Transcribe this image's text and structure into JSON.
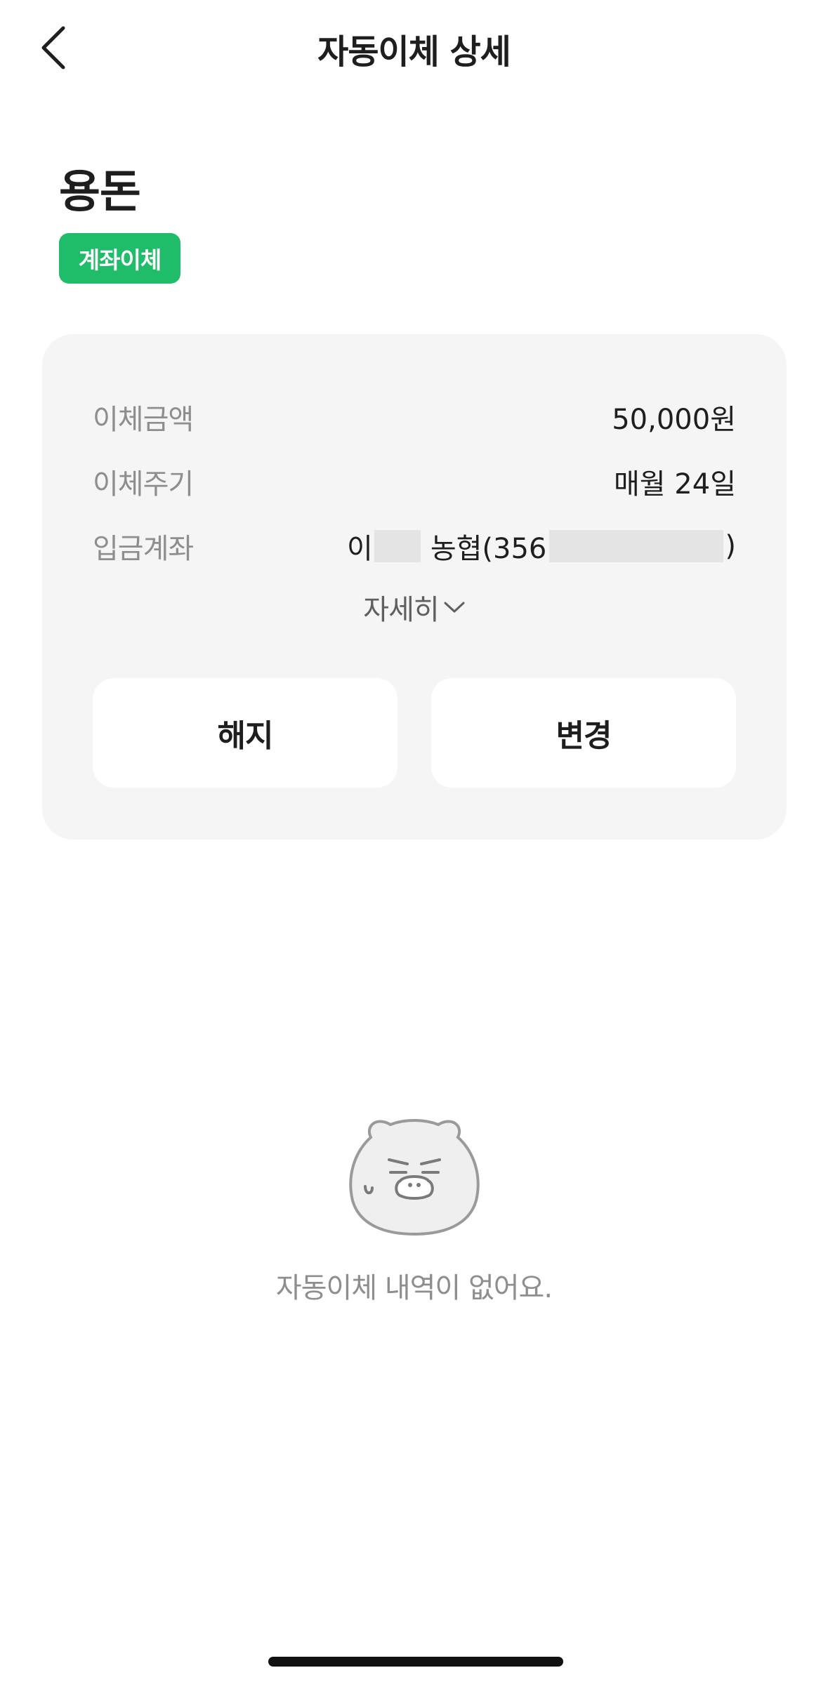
{
  "header": {
    "title": "자동이체 상세"
  },
  "transfer": {
    "name": "용돈",
    "type_badge": "계좌이체",
    "badge_color": "#1fbd6a"
  },
  "details": {
    "amount_label": "이체금액",
    "amount_value": "50,000원",
    "cycle_label": "이체주기",
    "cycle_value": "매월 24일",
    "account_label": "입금계좌",
    "account_name_prefix": "이",
    "account_bank": "농협(356",
    "account_suffix": ")",
    "more_label": "자세히"
  },
  "actions": {
    "cancel_label": "해지",
    "change_label": "변경"
  },
  "empty_state": {
    "message": "자동이체 내역이 없어요.",
    "icon": "character-icon"
  },
  "colors": {
    "accent": "#1fbd6a",
    "card_bg": "#f5f5f5",
    "muted_text": "#8e8e8e"
  }
}
